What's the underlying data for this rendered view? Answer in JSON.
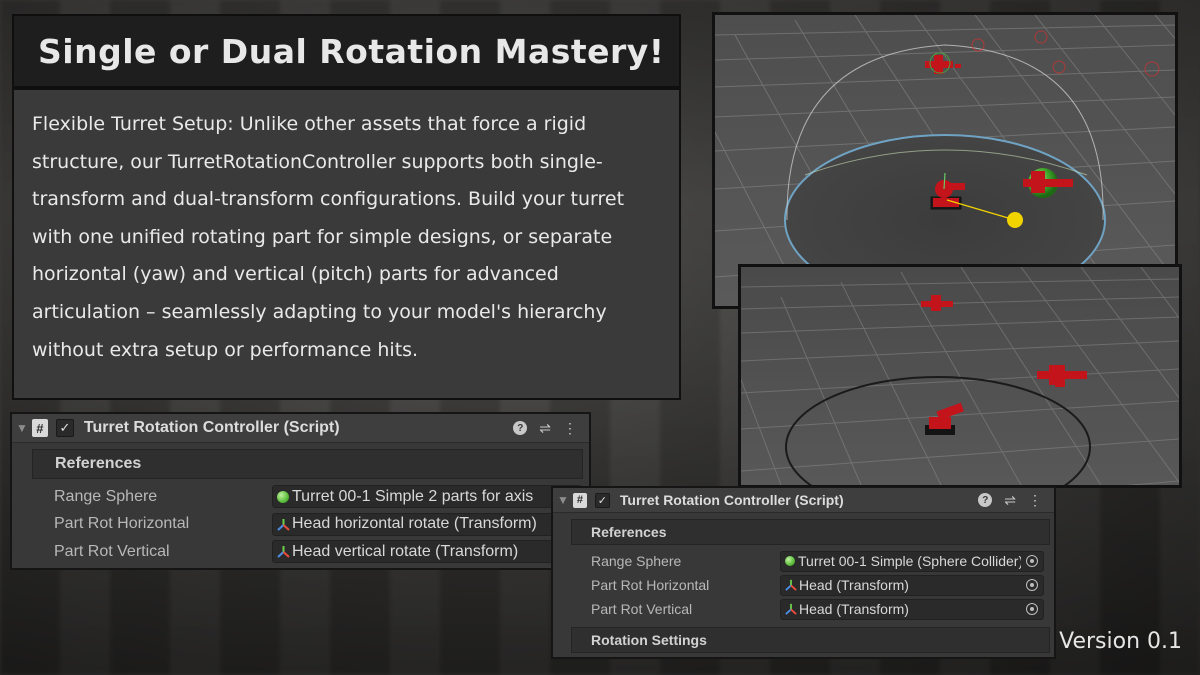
{
  "title": "Single or Dual Rotation Mastery!",
  "description": "Flexible Turret Setup: Unlike other assets that force a rigid structure, our TurretRotationController supports both single-transform and dual-transform configurations. Build your turret with one unified rotating part for simple designs, or separate horizontal (yaw) and vertical (pitch) parts for advanced articulation – seamlessly adapting to your model's hierarchy without extra setup or performance hits.",
  "version": "Version 0.1",
  "inspector_dual": {
    "component_title": "Turret Rotation Controller (Script)",
    "section": "References",
    "rows": [
      {
        "label": "Range Sphere",
        "value": "Turret 00-1 Simple 2 parts for axis"
      },
      {
        "label": "Part Rot Horizontal",
        "value": "Head horizontal rotate (Transform)"
      },
      {
        "label": "Part Rot Vertical",
        "value": "Head vertical rotate (Transform)"
      }
    ]
  },
  "inspector_single": {
    "component_title": "Turret Rotation Controller (Script)",
    "section": "References",
    "rows": [
      {
        "label": "Range Sphere",
        "value": "Turret 00-1 Simple (Sphere Collider)"
      },
      {
        "label": "Part Rot Horizontal",
        "value": "Head (Transform)"
      },
      {
        "label": "Part Rot Vertical",
        "value": "Head (Transform)"
      }
    ],
    "section2": "Rotation Settings"
  },
  "icons": {
    "foldout": "triangle-down-icon",
    "script": "script-hash-icon",
    "checkbox": "checkmark-icon",
    "help": "help-icon",
    "presets": "preset-sliders-icon",
    "menu": "kebab-menu-icon",
    "sphere": "sphere-collider-icon",
    "transform": "transform-axis-icon",
    "picker": "object-picker-icon"
  },
  "colors": {
    "title_bg": "#1e1e1e",
    "desc_bg": "#3a3a3a",
    "inspector_bg": "#383838",
    "turret_red": "#d0131b",
    "target_green": "#3fa52a",
    "gizmo_yellow": "#f1d300"
  }
}
